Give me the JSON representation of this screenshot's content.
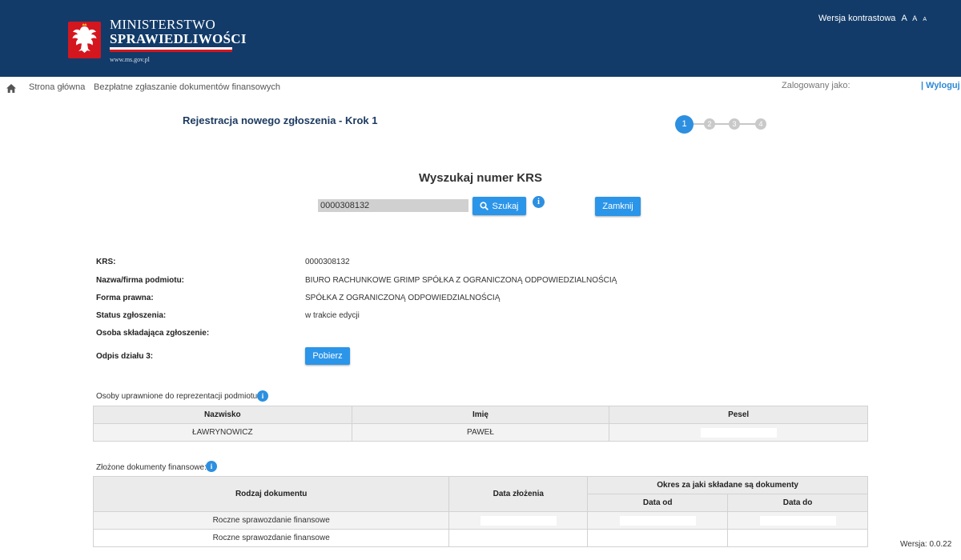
{
  "header": {
    "logo_line1": "MINISTERSTWO",
    "logo_line2": "SPRAWIEDLIWOŚCI",
    "logo_url": "www.ms.gov.pl",
    "contrast_label": "Wersja kontrastowa",
    "font_sizes": [
      "A",
      "A",
      "A"
    ]
  },
  "breadcrumb": {
    "home_icon": "home-icon",
    "items": [
      "Strona główna",
      "Bezpłatne zgłaszanie dokumentów finansowych"
    ]
  },
  "user": {
    "logged_label": "Zalogowany jako:",
    "logout_label": "| Wyloguj"
  },
  "page": {
    "title": "Rejestracja nowego zgłoszenia - Krok 1",
    "steps": [
      "1",
      "2",
      "3",
      "4"
    ],
    "active_step": 1
  },
  "search": {
    "title": "Wyszukaj numer KRS",
    "input_value": "0000308132",
    "search_button": "Szukaj",
    "close_button": "Zamknij",
    "info_icon": "i"
  },
  "details": {
    "krs_label": "KRS:",
    "krs_value": "0000308132",
    "name_label": "Nazwa/firma podmiotu:",
    "name_value": "BIURO RACHUNKOWE GRIMP SPÓŁKA Z OGRANICZONĄ ODPOWIEDZIALNOŚCIĄ",
    "legal_form_label": "Forma prawna:",
    "legal_form_value": "SPÓŁKA Z OGRANICZONĄ ODPOWIEDZIALNOŚCIĄ",
    "status_label": "Status zgłoszenia:",
    "status_value": "w trakcie edycji",
    "submitter_label": "Osoba składająca zgłoszenie:",
    "extract_label": "Odpis działu 3:",
    "download_button": "Pobierz"
  },
  "representatives": {
    "label": "Osoby uprawnione do reprezentacji podmiotu:",
    "columns": [
      "Nazwisko",
      "Imię",
      "Pesel"
    ],
    "rows": [
      {
        "surname": "ŁAWRYNOWICZ",
        "name": "PAWEŁ"
      }
    ]
  },
  "documents": {
    "label": "Złożone dokumenty finansowe:",
    "col_type": "Rodzaj dokumentu",
    "col_date": "Data złożenia",
    "col_period": "Okres za jaki składane są dokumenty",
    "col_from": "Data od",
    "col_to": "Data do",
    "rows": [
      {
        "type": "Roczne sprawozdanie finansowe"
      },
      {
        "type": "Roczne sprawozdanie finansowe"
      }
    ]
  },
  "footer": {
    "version": "Wersja: 0.0.22"
  },
  "colors": {
    "header_bg": "#123b69",
    "accent_blue": "#2b95e9",
    "title_blue": "#1c3a60",
    "emblem_red": "#d4161f"
  }
}
